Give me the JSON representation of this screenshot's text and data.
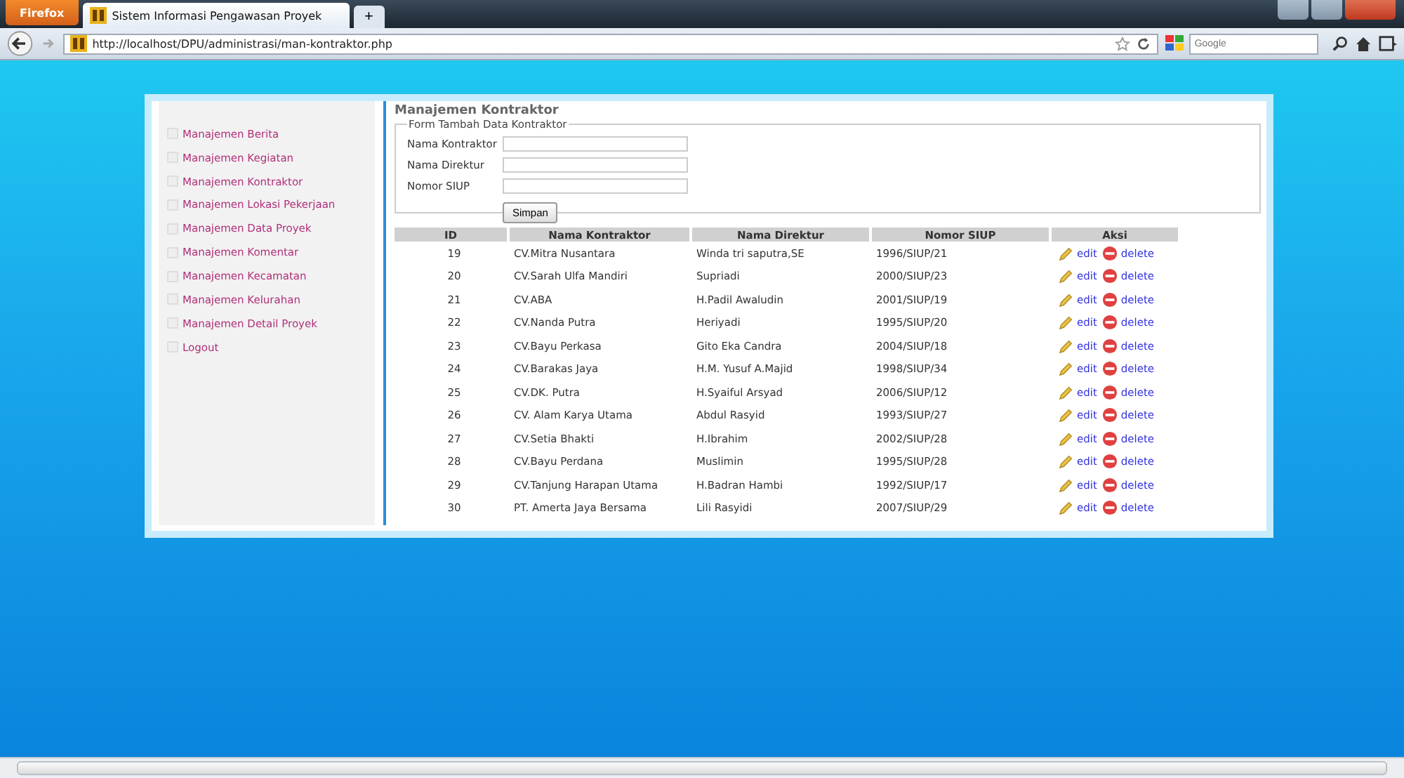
{
  "browser": {
    "menu_button": "Firefox",
    "tab_title": "Sistem Informasi Pengawasan Proyek",
    "new_tab": "+",
    "url": "http://localhost/DPU/administrasi/man-kontraktor.php",
    "search_placeholder": "Google"
  },
  "sidebar": {
    "items": [
      "Manajemen Berita",
      "Manajemen Kegiatan",
      "Manajemen Kontraktor",
      "Manajemen Lokasi Pekerjaan",
      "Manajemen Data Proyek",
      "Manajemen Komentar",
      "Manajemen Kecamatan",
      "Manajemen Kelurahan",
      "Manajemen Detail Proyek",
      "Logout"
    ]
  },
  "page_title": "Manajemen Kontraktor",
  "form": {
    "legend": "Form Tambah Data Kontraktor",
    "fields": [
      {
        "label": "Nama Kontraktor"
      },
      {
        "label": "Nama Direktur"
      },
      {
        "label": "Nomor SIUP"
      }
    ],
    "submit": "Simpan"
  },
  "table": {
    "columns": [
      "ID",
      "Nama Kontraktor",
      "Nama Direktur",
      "Nomor SIUP",
      "Aksi"
    ],
    "rows": [
      {
        "id": "19",
        "kontraktor": "CV.Mitra Nusantara",
        "direktur": "Winda tri saputra,SE",
        "siup": "1996/SIUP/21",
        "edit": "edit",
        "delete": "delete"
      },
      {
        "id": "20",
        "kontraktor": "CV.Sarah Ulfa Mandiri",
        "direktur": "Supriadi",
        "siup": "2000/SIUP/23",
        "edit": "edit",
        "delete": "delete"
      },
      {
        "id": "21",
        "kontraktor": "CV.ABA",
        "direktur": "H.Padil Awaludin",
        "siup": "2001/SIUP/19",
        "edit": "edit",
        "delete": "delete"
      },
      {
        "id": "22",
        "kontraktor": "CV.Nanda Putra",
        "direktur": "Heriyadi",
        "siup": "1995/SIUP/20",
        "edit": "edit",
        "delete": "delete"
      },
      {
        "id": "23",
        "kontraktor": "CV.Bayu Perkasa",
        "direktur": "Gito Eka Candra",
        "siup": "2004/SIUP/18",
        "edit": "edit",
        "delete": "delete"
      },
      {
        "id": "24",
        "kontraktor": "CV.Barakas Jaya",
        "direktur": "H.M. Yusuf A.Majid",
        "siup": "1998/SIUP/34",
        "edit": "edit",
        "delete": "delete"
      },
      {
        "id": "25",
        "kontraktor": "CV.DK. Putra",
        "direktur": "H.Syaiful Arsyad",
        "siup": "2006/SIUP/12",
        "edit": "edit",
        "delete": "delete"
      },
      {
        "id": "26",
        "kontraktor": "CV. Alam Karya Utama",
        "direktur": "Abdul Rasyid",
        "siup": "1993/SIUP/27",
        "edit": "edit",
        "delete": "delete"
      },
      {
        "id": "27",
        "kontraktor": "CV.Setia Bhakti",
        "direktur": "H.Ibrahim",
        "siup": "2002/SIUP/28",
        "edit": "edit",
        "delete": "delete"
      },
      {
        "id": "28",
        "kontraktor": "CV.Bayu Perdana",
        "direktur": "Muslimin",
        "siup": "1995/SIUP/28",
        "edit": "edit",
        "delete": "delete"
      },
      {
        "id": "29",
        "kontraktor": "CV.Tanjung Harapan Utama",
        "direktur": "H.Badran Hambi",
        "siup": "1992/SIUP/17",
        "edit": "edit",
        "delete": "delete"
      },
      {
        "id": "30",
        "kontraktor": "PT. Amerta Jaya Bersama",
        "direktur": "Lili Rasyidi",
        "siup": "2007/SIUP/29",
        "edit": "edit",
        "delete": "delete"
      }
    ]
  }
}
